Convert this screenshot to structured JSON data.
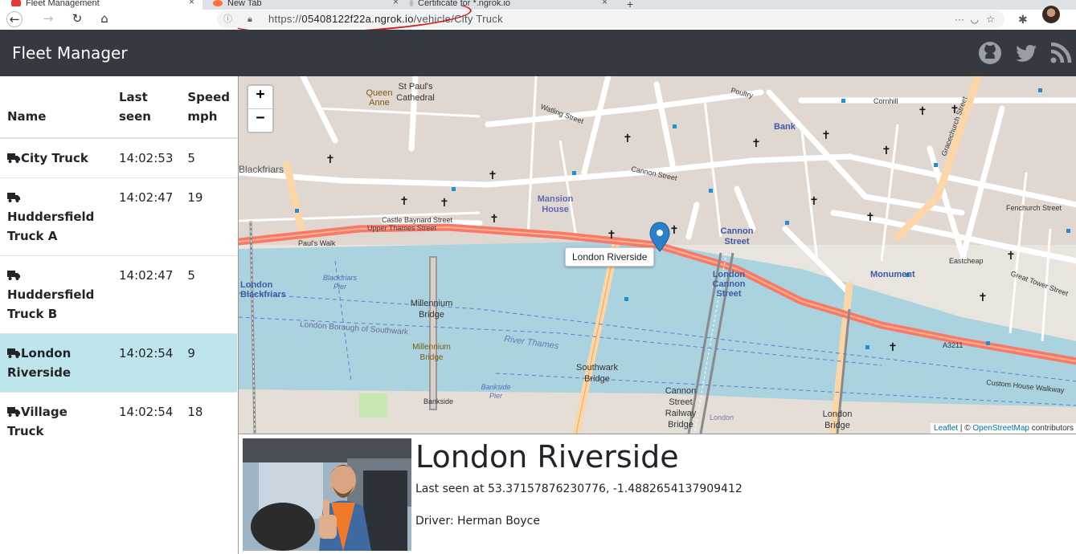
{
  "browser": {
    "tabs": [
      {
        "label": "Fleet Management",
        "color": "#e53935",
        "active": true
      },
      {
        "label": "New Tab",
        "color": "#ff6f3c",
        "active": false
      },
      {
        "label": "Certificate for *.ngrok.io",
        "color": "#bdbdbd",
        "active": false
      }
    ],
    "url_host": "05408122f22a.ngrok.io",
    "url_scheme": "https://",
    "url_path": "/vehicle/City Truck"
  },
  "app": {
    "brand": "Fleet Manager",
    "nav_icons": [
      "github-icon",
      "twitter-icon",
      "rss-icon"
    ]
  },
  "table": {
    "headers": {
      "name": "Name",
      "last_seen": "Last seen",
      "speed": "Speed mph"
    },
    "rows": [
      {
        "name": "City Truck",
        "last_seen": "14:02:53",
        "speed": "5"
      },
      {
        "name": "Huddersfield Truck A",
        "last_seen": "14:02:47",
        "speed": "19"
      },
      {
        "name": "Huddersfield Truck B",
        "last_seen": "14:02:47",
        "speed": "5"
      },
      {
        "name": "London Riverside",
        "last_seen": "14:02:54",
        "speed": "9"
      },
      {
        "name": "Village Truck",
        "last_seen": "14:02:54",
        "speed": "18"
      }
    ],
    "selected_row_color": "#bee5eb"
  },
  "map": {
    "zoom_in": "+",
    "zoom_out": "−",
    "tooltip": "London Riverside",
    "attribution_leaflet": "Leaflet",
    "attribution_sep": " | © ",
    "attribution_osm": "OpenStreetMap",
    "attribution_suffix": " contributors",
    "labels": {
      "stpauls": "St Paul's",
      "cathedral": "Cathedral",
      "queen_anne": "Queen",
      "queen_anne2": "Anne",
      "watling": "Watling Street",
      "poultry": "Poultry",
      "cornhill": "Cornhill",
      "bank": "Bank",
      "cannon_st": "Cannon Street",
      "mansion": "Mansion",
      "mansion2": "House",
      "blackfriars": "Blackfriars",
      "castle_baynard": "Castle Baynard Street",
      "upper_thames": "Upper Thames Street",
      "pauls_walk": "Paul's Walk",
      "blackfriars_pier": "Blackfriars",
      "blackfriars_pier2": "Pier",
      "millennium": "Millennium",
      "millennium2": "Bridge",
      "southwark_borough": "London Borough of Southwark",
      "river_thames": "River Thames",
      "southwark_bridge": "Southwark",
      "southwark_bridge2": "Bridge",
      "bankside_pier": "Bankside",
      "bankside_pier2": "Pier",
      "bankside": "Bankside",
      "cannon_rail": "Cannon",
      "cannon_rail2": "Street",
      "cannon_rail3": "Railway",
      "cannon_rail4": "Bridge",
      "london_bridge": "London",
      "london_bridge2": "Bridge",
      "monument": "Monument",
      "fenchurch": "Fenchurch Street",
      "eastcheap": "Eastcheap",
      "great_tower": "Great Tower Street",
      "custom_house": "Custom House Walkway",
      "a3211": "A3211",
      "cannon_street_stn": "Cannon",
      "cannon_street_stn2": "Street",
      "london_cannon": "London",
      "london_cannon2": "Cannon",
      "london_cannon3": "Street",
      "london_blackfriars": "London",
      "london_blackfriars2": "Blackfriars",
      "gracechurch": "Gracechurch Street",
      "london_sw": "London"
    }
  },
  "detail": {
    "title": "London Riverside",
    "last_seen": "Last seen at 53.37157876230776, -1.4882654137909412",
    "driver": "Driver: Herman Boyce"
  }
}
